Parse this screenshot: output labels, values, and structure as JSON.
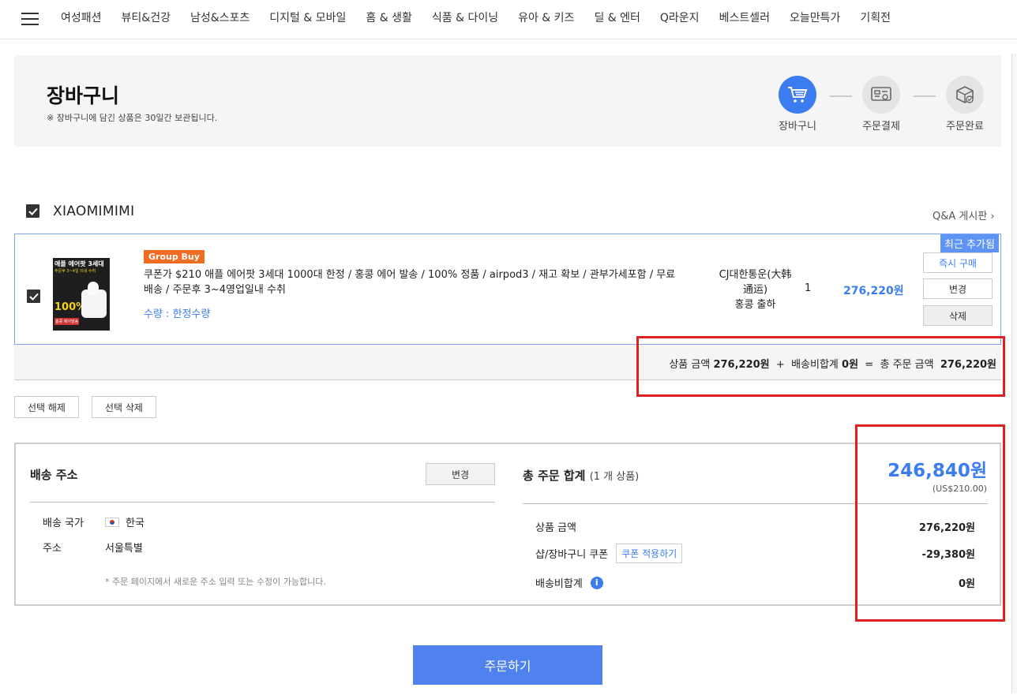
{
  "nav": {
    "items": [
      "여성패션",
      "뷰티&건강",
      "남성&스포츠",
      "디지털 & 모바일",
      "홈 & 생활",
      "식품 & 다이닝",
      "유아 & 키즈",
      "딜 & 엔터",
      "Q라운지",
      "베스트셀러",
      "오늘만특가",
      "기획전"
    ]
  },
  "header": {
    "title": "장바구니",
    "note": "※ 장바구니에 담긴 상품은 30일간 보관됩니다.",
    "steps": [
      {
        "label": "장바구니",
        "icon": "cart-icon",
        "active": true
      },
      {
        "label": "주문결제",
        "icon": "payment-card-icon",
        "active": false
      },
      {
        "label": "주문완료",
        "icon": "box-check-icon",
        "active": false
      }
    ]
  },
  "seller": {
    "name": "XIAOMIMIMI",
    "qna_link": "Q&A 게시판 ›"
  },
  "item": {
    "badge": "Group Buy",
    "title": "쿠폰가 $210 애플 에어팟 3세대 1000대 한정 / 홍콩 에어 발송 / 100% 정품 / airpod3 / 재고 확보 / 관부가세포함 / 무료배송 / 주문후 3~4영업일내 수취",
    "option": "수량 : 한정수량",
    "shipping": "CJ대한통운(大韩通运)\n홍콩 출하",
    "quantity": "1",
    "price": "276,220원",
    "recent_tag": "최근 추가됨",
    "buttons": {
      "buy_now": "즉시 구매",
      "change": "변경",
      "delete": "삭제"
    },
    "thumb_text": {
      "line1": "애플 에어팟 3세대",
      "line2": "주문후 3~4일 이내 수취",
      "line3": "100%",
      "line4": "홍콩 에어발송"
    }
  },
  "subtotal": {
    "product_label": "상품 금액",
    "product_value": "276,220원",
    "plus": "+",
    "shipping_label": "배송비합계",
    "shipping_value": "0원",
    "equals": "=",
    "total_label": "총 주문 금액",
    "total_value": "276,220원"
  },
  "selection": {
    "deselect": "선택 해제",
    "delete_selected": "선택 삭제"
  },
  "address": {
    "title": "배송 주소",
    "change": "변경",
    "country_label": "배송 국가",
    "country_value": "한국",
    "address_label": "주소",
    "address_value": "서울특별",
    "note": "* 주문 페이지에서 새로운 주소 입력 또는 수정이 가능합니다."
  },
  "summary": {
    "title": "총 주문 합계",
    "count": "(1 개 상품)",
    "total": "246,840원",
    "usd": "(US$210.00)",
    "product_label": "상품 금액",
    "product_value": "276,220원",
    "coupon_label": "샵/장바구니 쿠폰",
    "coupon_button": "쿠폰 적용하기",
    "coupon_value": "-29,380원",
    "shipping_label": "배송비합계",
    "shipping_value": "0원"
  },
  "order_button": "주문하기",
  "colors": {
    "accent": "#3b7df0",
    "order_button": "#4f82ef",
    "badge": "#f26d21",
    "highlight_box": "#e02020"
  }
}
